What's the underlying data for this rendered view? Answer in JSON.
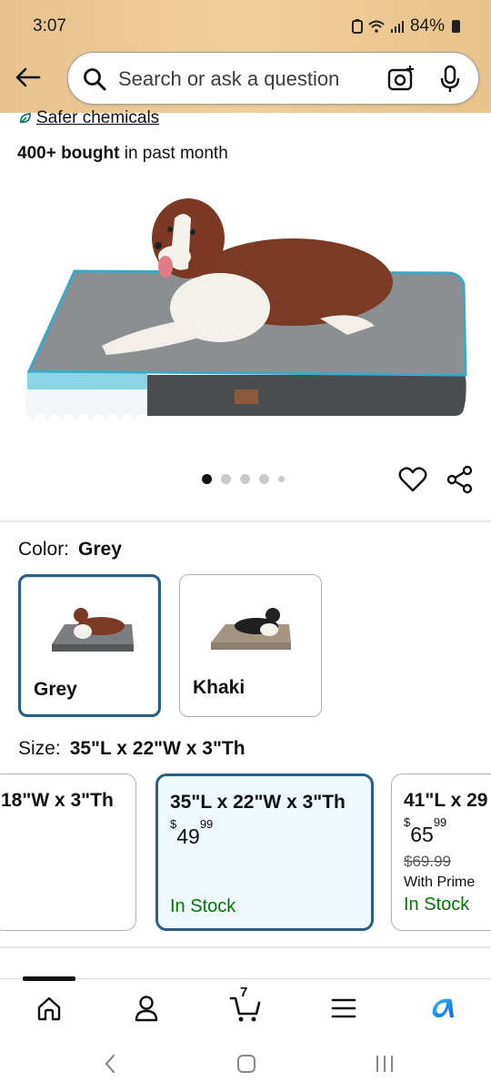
{
  "status": {
    "time": "3:07",
    "battery": "84%"
  },
  "search": {
    "placeholder": "Search or ask a question"
  },
  "product": {
    "safer_chemicals": "Safer chemicals",
    "bought_bold": "400+ bought",
    "bought_rest": " in past month",
    "image_dots": 5,
    "active_dot": 0
  },
  "color": {
    "label": "Color:",
    "selected": "Grey",
    "options": [
      {
        "label": "Grey",
        "bed_color": "#7b7e80"
      },
      {
        "label": "Khaki",
        "bed_color": "#a39582"
      }
    ]
  },
  "size": {
    "label": "Size:",
    "selected": "35\"L x 22\"W x 3\"Th",
    "options": [
      {
        "title": "18\"W x 3\"Th"
      },
      {
        "title": "35\"L x 22\"W x 3\"Th",
        "price_dollars": "49",
        "price_cents": "99",
        "stock": "In Stock"
      },
      {
        "title": "41\"L x 29",
        "price_dollars": "65",
        "price_cents": "99",
        "list_price": "$69.99",
        "prime": "With Prime",
        "stock": "In Stock"
      }
    ],
    "currency": "$"
  },
  "nav": {
    "cart_count": "7"
  },
  "colors": {
    "header": "#efcc99",
    "selected_border": "#2d5f84",
    "in_stock": "#007600",
    "link": "#0f1111"
  }
}
